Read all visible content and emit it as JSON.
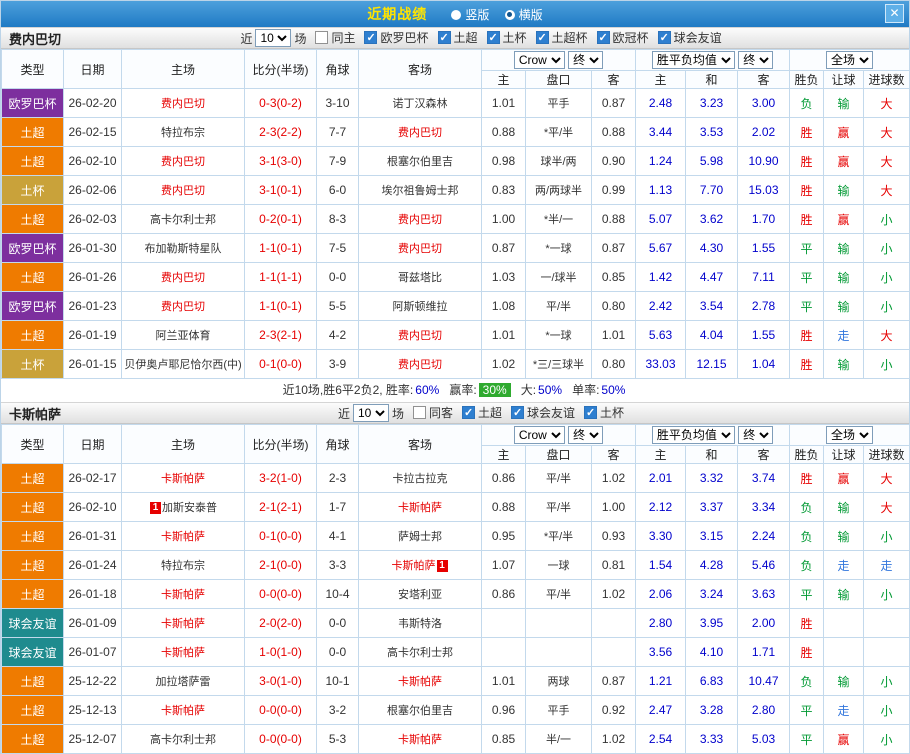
{
  "colors": {
    "type": {
      "欧罗巴杯": "#7d2f9e",
      "土超": "#ef7b00",
      "土杯": "#c9a23a",
      "球会友谊": "#1f8b8e"
    },
    "result": {
      "red": "#e60000",
      "green": "#009933",
      "blue": "#3377dd"
    },
    "team": "#e60000",
    "score": "#e60000",
    "mean": "#0000cc",
    "topbar": "#1f7ac4",
    "title": "#ffe400"
  },
  "top_bar": {
    "title": "近期战绩",
    "options": [
      {
        "label": "竖版",
        "selected": false
      },
      {
        "label": "横版",
        "selected": true
      }
    ],
    "close": "✕"
  },
  "table": {
    "cols": [
      "类型",
      "日期",
      "主场",
      "比分(半场)",
      "角球",
      "客场"
    ],
    "subcols": [
      "主",
      "盘口",
      "客",
      "主",
      "和",
      "客",
      "胜负",
      "让球",
      "进球数"
    ],
    "book": "Crow",
    "stage1": "终",
    "mean_label": "胜平负均值",
    "stage2": "终",
    "scope": "全场"
  },
  "sections": [
    {
      "team": "费内巴切",
      "filters": {
        "near": "近",
        "count": "10",
        "games": "场",
        "checkboxes": [
          {
            "label": "同主",
            "checked": false
          },
          {
            "label": "欧罗巴杯",
            "checked": true
          },
          {
            "label": "土超",
            "checked": true
          },
          {
            "label": "土杯",
            "checked": true
          },
          {
            "label": "土超杯",
            "checked": true
          },
          {
            "label": "欧冠杯",
            "checked": true
          },
          {
            "label": "球会友谊",
            "checked": true
          }
        ]
      },
      "rows": [
        {
          "type": "欧罗巴杯",
          "date": "26-02-20",
          "home": {
            "name": "费内巴切",
            "red": true
          },
          "score": "0-3(0-2)",
          "corner": "3-10",
          "away": {
            "name": "诺丁汉森林",
            "red": false
          },
          "odds": [
            "1.01",
            "平手",
            "0.87"
          ],
          "mean": [
            "2.48",
            "3.23",
            "3.00"
          ],
          "results": [
            {
              "t": "负",
              "c": "green"
            },
            {
              "t": "输",
              "c": "green"
            },
            {
              "t": "大",
              "c": "red"
            }
          ]
        },
        {
          "type": "土超",
          "date": "26-02-15",
          "home": {
            "name": "特拉布宗",
            "red": false
          },
          "score": "2-3(2-2)",
          "corner": "7-7",
          "away": {
            "name": "费内巴切",
            "red": true
          },
          "odds": [
            "0.88",
            "*平/半",
            "0.88"
          ],
          "mean": [
            "3.44",
            "3.53",
            "2.02"
          ],
          "results": [
            {
              "t": "胜",
              "c": "red"
            },
            {
              "t": "赢",
              "c": "red"
            },
            {
              "t": "大",
              "c": "red"
            }
          ]
        },
        {
          "type": "土超",
          "date": "26-02-10",
          "home": {
            "name": "费内巴切",
            "red": true
          },
          "score": "3-1(3-0)",
          "corner": "7-9",
          "away": {
            "name": "根塞尔伯里吉",
            "red": false
          },
          "odds": [
            "0.98",
            "球半/两",
            "0.90"
          ],
          "mean": [
            "1.24",
            "5.98",
            "10.90"
          ],
          "results": [
            {
              "t": "胜",
              "c": "red"
            },
            {
              "t": "赢",
              "c": "red"
            },
            {
              "t": "大",
              "c": "red"
            }
          ]
        },
        {
          "type": "土杯",
          "date": "26-02-06",
          "home": {
            "name": "费内巴切",
            "red": true
          },
          "score": "3-1(0-1)",
          "corner": "6-0",
          "away": {
            "name": "埃尔祖鲁姆士邦",
            "red": false
          },
          "odds": [
            "0.83",
            "两/两球半",
            "0.99"
          ],
          "mean": [
            "1.13",
            "7.70",
            "15.03"
          ],
          "results": [
            {
              "t": "胜",
              "c": "red"
            },
            {
              "t": "输",
              "c": "green"
            },
            {
              "t": "大",
              "c": "red"
            }
          ]
        },
        {
          "type": "土超",
          "date": "26-02-03",
          "home": {
            "name": "高卡尔利士邦",
            "red": false
          },
          "score": "0-2(0-1)",
          "corner": "8-3",
          "away": {
            "name": "费内巴切",
            "red": true
          },
          "odds": [
            "1.00",
            "*半/一",
            "0.88"
          ],
          "mean": [
            "5.07",
            "3.62",
            "1.70"
          ],
          "results": [
            {
              "t": "胜",
              "c": "red"
            },
            {
              "t": "赢",
              "c": "red"
            },
            {
              "t": "小",
              "c": "green"
            }
          ]
        },
        {
          "type": "欧罗巴杯",
          "date": "26-01-30",
          "home": {
            "name": "布加勒斯特星队",
            "red": false
          },
          "score": "1-1(0-1)",
          "corner": "7-5",
          "away": {
            "name": "费内巴切",
            "red": true
          },
          "odds": [
            "0.87",
            "*一球",
            "0.87"
          ],
          "mean": [
            "5.67",
            "4.30",
            "1.55"
          ],
          "results": [
            {
              "t": "平",
              "c": "green"
            },
            {
              "t": "输",
              "c": "green"
            },
            {
              "t": "小",
              "c": "green"
            }
          ]
        },
        {
          "type": "土超",
          "date": "26-01-26",
          "home": {
            "name": "费内巴切",
            "red": true
          },
          "score": "1-1(1-1)",
          "corner": "0-0",
          "away": {
            "name": "哥兹塔比",
            "red": false
          },
          "odds": [
            "1.03",
            "一/球半",
            "0.85"
          ],
          "mean": [
            "1.42",
            "4.47",
            "7.11"
          ],
          "results": [
            {
              "t": "平",
              "c": "green"
            },
            {
              "t": "输",
              "c": "green"
            },
            {
              "t": "小",
              "c": "green"
            }
          ]
        },
        {
          "type": "欧罗巴杯",
          "date": "26-01-23",
          "home": {
            "name": "费内巴切",
            "red": true
          },
          "score": "1-1(0-1)",
          "corner": "5-5",
          "away": {
            "name": "阿斯顿维拉",
            "red": false
          },
          "odds": [
            "1.08",
            "平/半",
            "0.80"
          ],
          "mean": [
            "2.42",
            "3.54",
            "2.78"
          ],
          "results": [
            {
              "t": "平",
              "c": "green"
            },
            {
              "t": "输",
              "c": "green"
            },
            {
              "t": "小",
              "c": "green"
            }
          ]
        },
        {
          "type": "土超",
          "date": "26-01-19",
          "home": {
            "name": "阿兰亚体育",
            "red": false
          },
          "score": "2-3(2-1)",
          "corner": "4-2",
          "away": {
            "name": "费内巴切",
            "red": true
          },
          "odds": [
            "1.01",
            "*一球",
            "1.01"
          ],
          "mean": [
            "5.63",
            "4.04",
            "1.55"
          ],
          "results": [
            {
              "t": "胜",
              "c": "red"
            },
            {
              "t": "走",
              "c": "blue"
            },
            {
              "t": "大",
              "c": "red"
            }
          ]
        },
        {
          "type": "土杯",
          "date": "26-01-15",
          "home": {
            "name": "贝伊奥卢耶尼恰尔西(中)",
            "red": false
          },
          "score": "0-1(0-0)",
          "corner": "3-9",
          "away": {
            "name": "费内巴切",
            "red": true
          },
          "odds": [
            "1.02",
            "*三/三球半",
            "0.80"
          ],
          "mean": [
            "33.03",
            "12.15",
            "1.04"
          ],
          "results": [
            {
              "t": "胜",
              "c": "red"
            },
            {
              "t": "输",
              "c": "green"
            },
            {
              "t": "小",
              "c": "green"
            }
          ]
        }
      ],
      "summary": {
        "prefix": "近10场,胜6平2负2, 胜率:",
        "win_rate": "60%",
        "label_win": "赢率:",
        "win_odds_rate": "30%",
        "label_big": "大:",
        "big_rate": "50%",
        "label_single": "单率:",
        "single_rate": "50%"
      }
    },
    {
      "team": "卡斯帕萨",
      "filters": {
        "near": "近",
        "count": "10",
        "games": "场",
        "checkboxes": [
          {
            "label": "同客",
            "checked": false
          },
          {
            "label": "土超",
            "checked": true
          },
          {
            "label": "球会友谊",
            "checked": true
          },
          {
            "label": "土杯",
            "checked": true
          }
        ]
      },
      "rows": [
        {
          "type": "土超",
          "date": "26-02-17",
          "home": {
            "name": "卡斯帕萨",
            "red": true
          },
          "score": "3-2(1-0)",
          "corner": "2-3",
          "away": {
            "name": "卡拉古拉克",
            "red": false
          },
          "odds": [
            "0.86",
            "平/半",
            "1.02"
          ],
          "mean": [
            "2.01",
            "3.32",
            "3.74"
          ],
          "results": [
            {
              "t": "胜",
              "c": "red"
            },
            {
              "t": "赢",
              "c": "red"
            },
            {
              "t": "大",
              "c": "red"
            }
          ]
        },
        {
          "type": "土超",
          "date": "26-02-10",
          "home": {
            "name": "加斯安泰普",
            "red": false,
            "badge": "1",
            "badge_pos": "before"
          },
          "score": "2-1(2-1)",
          "corner": "1-7",
          "away": {
            "name": "卡斯帕萨",
            "red": true
          },
          "odds": [
            "0.88",
            "平/半",
            "1.00"
          ],
          "mean": [
            "2.12",
            "3.37",
            "3.34"
          ],
          "results": [
            {
              "t": "负",
              "c": "green"
            },
            {
              "t": "输",
              "c": "green"
            },
            {
              "t": "大",
              "c": "red"
            }
          ]
        },
        {
          "type": "土超",
          "date": "26-01-31",
          "home": {
            "name": "卡斯帕萨",
            "red": true
          },
          "score": "0-1(0-0)",
          "corner": "4-1",
          "away": {
            "name": "萨姆士邦",
            "red": false
          },
          "odds": [
            "0.95",
            "*平/半",
            "0.93"
          ],
          "mean": [
            "3.30",
            "3.15",
            "2.24"
          ],
          "results": [
            {
              "t": "负",
              "c": "green"
            },
            {
              "t": "输",
              "c": "green"
            },
            {
              "t": "小",
              "c": "green"
            }
          ]
        },
        {
          "type": "土超",
          "date": "26-01-24",
          "home": {
            "name": "特拉布宗",
            "red": false
          },
          "score": "2-1(0-0)",
          "corner": "3-3",
          "away": {
            "name": "卡斯帕萨",
            "red": true,
            "badge": "1",
            "badge_pos": "after"
          },
          "odds": [
            "1.07",
            "一球",
            "0.81"
          ],
          "mean": [
            "1.54",
            "4.28",
            "5.46"
          ],
          "results": [
            {
              "t": "负",
              "c": "green"
            },
            {
              "t": "走",
              "c": "blue"
            },
            {
              "t": "走",
              "c": "blue"
            }
          ]
        },
        {
          "type": "土超",
          "date": "26-01-18",
          "home": {
            "name": "卡斯帕萨",
            "red": true
          },
          "score": "0-0(0-0)",
          "corner": "10-4",
          "away": {
            "name": "安塔利亚",
            "red": false
          },
          "odds": [
            "0.86",
            "平/半",
            "1.02"
          ],
          "mean": [
            "2.06",
            "3.24",
            "3.63"
          ],
          "results": [
            {
              "t": "平",
              "c": "green"
            },
            {
              "t": "输",
              "c": "green"
            },
            {
              "t": "小",
              "c": "green"
            }
          ]
        },
        {
          "type": "球会友谊",
          "date": "26-01-09",
          "home": {
            "name": "卡斯帕萨",
            "red": true
          },
          "score": "2-0(2-0)",
          "corner": "0-0",
          "away": {
            "name": "韦斯特洛",
            "red": false
          },
          "odds": [
            "",
            "",
            ""
          ],
          "mean": [
            "2.80",
            "3.95",
            "2.00"
          ],
          "results": [
            {
              "t": "胜",
              "c": "red"
            },
            null,
            null
          ]
        },
        {
          "type": "球会友谊",
          "date": "26-01-07",
          "home": {
            "name": "卡斯帕萨",
            "red": true
          },
          "score": "1-0(1-0)",
          "corner": "0-0",
          "away": {
            "name": "高卡尔利士邦",
            "red": false
          },
          "odds": [
            "",
            "",
            ""
          ],
          "mean": [
            "3.56",
            "4.10",
            "1.71"
          ],
          "results": [
            {
              "t": "胜",
              "c": "red"
            },
            null,
            null
          ]
        },
        {
          "type": "土超",
          "date": "25-12-22",
          "home": {
            "name": "加拉塔萨雷",
            "red": false
          },
          "score": "3-0(1-0)",
          "corner": "10-1",
          "away": {
            "name": "卡斯帕萨",
            "red": true
          },
          "odds": [
            "1.01",
            "两球",
            "0.87"
          ],
          "mean": [
            "1.21",
            "6.83",
            "10.47"
          ],
          "results": [
            {
              "t": "负",
              "c": "green"
            },
            {
              "t": "输",
              "c": "green"
            },
            {
              "t": "小",
              "c": "green"
            }
          ]
        },
        {
          "type": "土超",
          "date": "25-12-13",
          "home": {
            "name": "卡斯帕萨",
            "red": true
          },
          "score": "0-0(0-0)",
          "corner": "3-2",
          "away": {
            "name": "根塞尔伯里吉",
            "red": false
          },
          "odds": [
            "0.96",
            "平手",
            "0.92"
          ],
          "mean": [
            "2.47",
            "3.28",
            "2.80"
          ],
          "results": [
            {
              "t": "平",
              "c": "green"
            },
            {
              "t": "走",
              "c": "blue"
            },
            {
              "t": "小",
              "c": "green"
            }
          ]
        },
        {
          "type": "土超",
          "date": "25-12-07",
          "home": {
            "name": "高卡尔利士邦",
            "red": false
          },
          "score": "0-0(0-0)",
          "corner": "5-3",
          "away": {
            "name": "卡斯帕萨",
            "red": true
          },
          "odds": [
            "0.85",
            "半/一",
            "1.02"
          ],
          "mean": [
            "2.54",
            "3.33",
            "5.03"
          ],
          "results": [
            {
              "t": "平",
              "c": "green"
            },
            {
              "t": "赢",
              "c": "red"
            },
            {
              "t": "小",
              "c": "green"
            }
          ]
        }
      ]
    }
  ]
}
